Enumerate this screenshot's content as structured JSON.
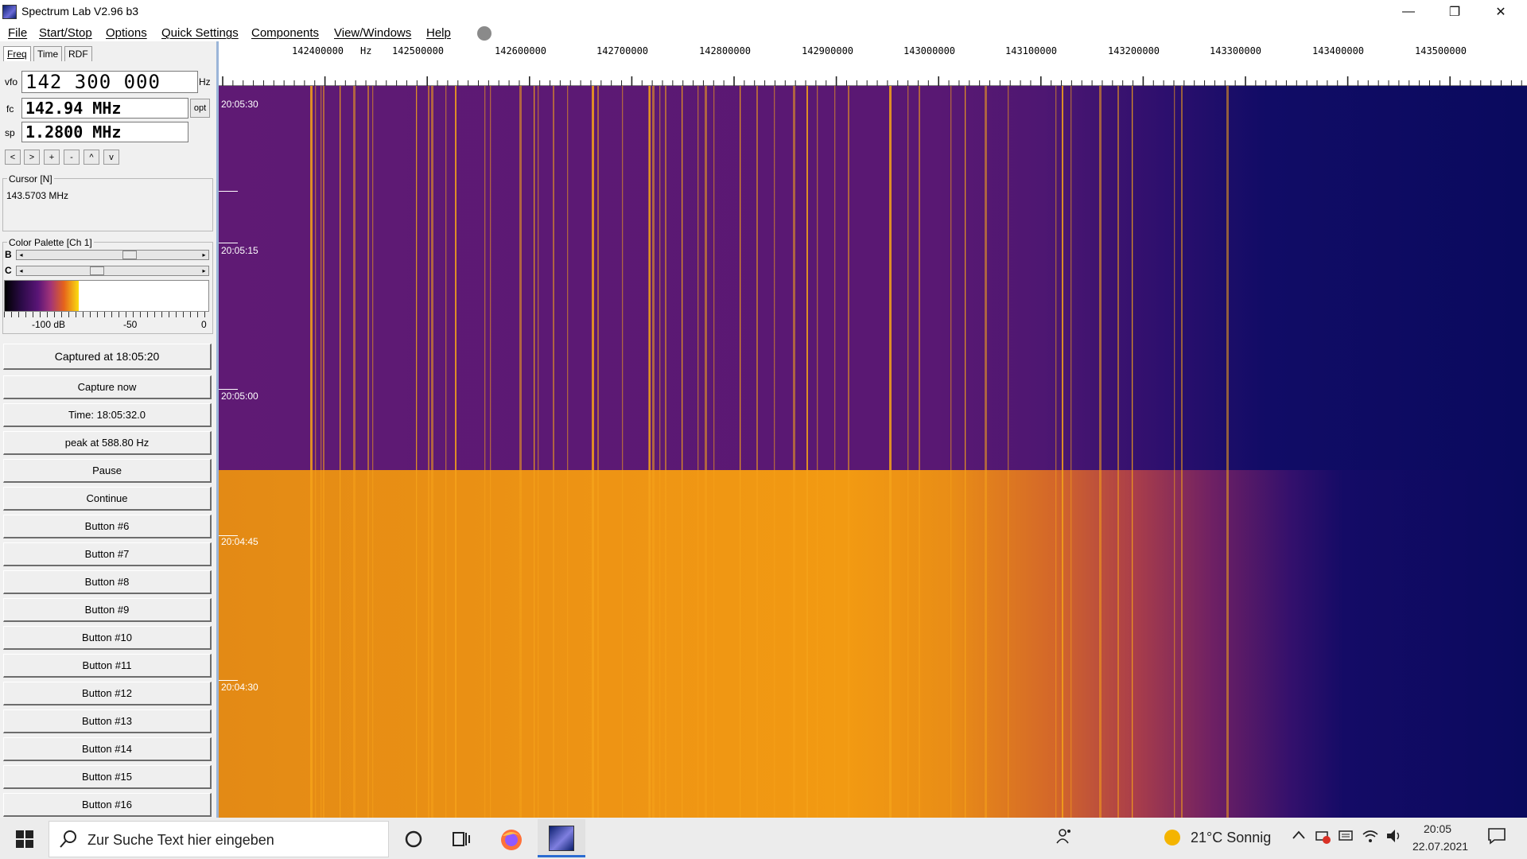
{
  "window": {
    "title": "Spectrum Lab V2.96 b3",
    "minimize_glyph": "—",
    "restore_glyph": "❐",
    "close_glyph": "✕"
  },
  "menu": {
    "items": [
      "File",
      "Start/Stop",
      "Options",
      "Quick Settings",
      "Components",
      "View/Windows",
      "Help"
    ]
  },
  "left_panel": {
    "tabs": [
      "Freq",
      "Time",
      "RDF"
    ],
    "vfo_label": "vfo",
    "vfo_value": "142 300 000",
    "vfo_unit": "Hz",
    "fc_label": "fc",
    "fc_value": "142.94 MHz",
    "opt_label": "opt",
    "sp_label": "sp",
    "sp_value": "1.2800 MHz",
    "nav_buttons": [
      "<",
      ">",
      "+",
      "-",
      "^",
      "v"
    ],
    "cursor_title": "Cursor [N]",
    "cursor_value": "143.5703 MHz",
    "palette_title": "Color Palette [Ch 1]",
    "b_label": "B",
    "c_label": "C",
    "b_slider_level": 0.6,
    "c_slider_level": 0.4,
    "palette_scale": [
      "-100 dB",
      "-50",
      "0"
    ],
    "buttons": [
      "Captured at 18:05:20",
      "Capture now",
      "Time:  18:05:32.0",
      "peak at 588.80 Hz",
      "Pause",
      "Continue",
      "Button #6",
      "Button #7",
      "Button #8",
      "Button #9",
      "Button #10",
      "Button #11",
      "Button #12",
      "Button #13",
      "Button #14",
      "Button #15",
      "Button #16"
    ]
  },
  "spectrogram": {
    "freq_labels": [
      "142400000",
      "Hz",
      "142500000",
      "142600000",
      "142700000",
      "142800000",
      "142900000",
      "143000000",
      "143100000",
      "143200000",
      "143300000",
      "143400000",
      "143500000"
    ],
    "time_labels": [
      "20:05:30",
      "20:05:15",
      "20:05:00",
      "20:04:45",
      "20:04:30"
    ],
    "colors": {
      "top_band": "#5f1a74",
      "bottom_band": "#ee9414",
      "high_freq": "#0a0a5e",
      "signal": "#f5a21a"
    }
  },
  "taskbar": {
    "search_placeholder": "Zur Suche Text hier eingeben",
    "weather": "21°C  Sonnig",
    "time": "20:05",
    "date": "22.07.2021",
    "icons": [
      "windows-start-icon",
      "search-icon",
      "cortana-icon",
      "task-view-icon",
      "firefox-icon",
      "spectrum-lab-icon",
      "people-icon",
      "weather-sun-icon",
      "chevron-up-icon",
      "network-icon",
      "input-icon",
      "wifi-icon",
      "volume-icon",
      "notifications-icon"
    ]
  }
}
